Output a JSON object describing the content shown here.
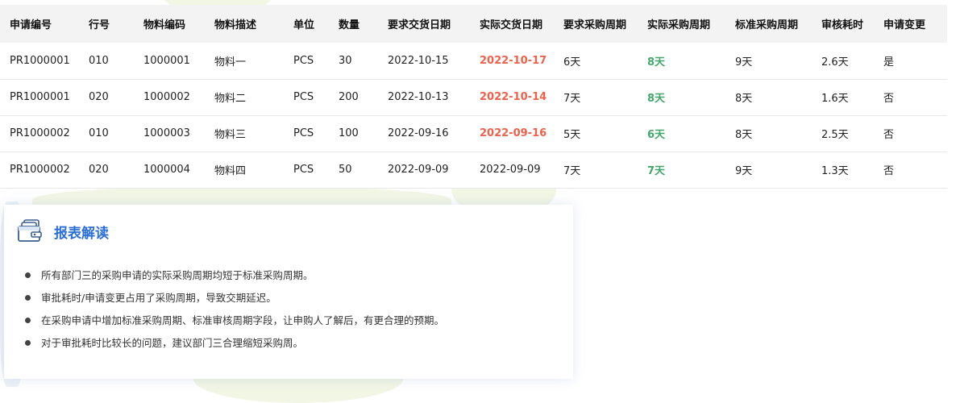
{
  "table": {
    "headers": [
      "申请编号",
      "行号",
      "物料编码",
      "物料描述",
      "单位",
      "数量",
      "要求交货日期",
      "实际交货日期",
      "要求采购周期",
      "实际采购周期",
      "标准采购周期",
      "审核耗时",
      "申请变更"
    ],
    "rows": [
      [
        "PR1000001",
        "010",
        "1000001",
        "物料一",
        "PCS",
        "30",
        "2022-10-15",
        "2022-10-17",
        "6天",
        "8天",
        "9天",
        "2.6天",
        "是"
      ],
      [
        "PR1000001",
        "020",
        "1000002",
        "物料二",
        "PCS",
        "200",
        "2022-10-13",
        "2022-10-14",
        "7天",
        "8天",
        "8天",
        "1.6天",
        "否"
      ],
      [
        "PR1000002",
        "010",
        "1000003",
        "物料三",
        "PCS",
        "100",
        "2022-09-16",
        "2022-09-16",
        "5天",
        "6天",
        "8天",
        "2.5天",
        "否"
      ],
      [
        "PR1000002",
        "020",
        "1000004",
        "物料四",
        "PCS",
        "50",
        "2022-09-09",
        "2022-09-09",
        "7天",
        "7天",
        "9天",
        "1.3天",
        "否"
      ]
    ],
    "late_delivery_highlight": [
      true,
      true,
      true,
      false
    ],
    "colors": {
      "late": "#f0604a",
      "good": "#43a66a",
      "header_bg": "#f3f3f3"
    }
  },
  "report": {
    "title": "报表解读",
    "icon": "document-stack-icon",
    "title_color": "#2b6fd6",
    "points": [
      "所有部门三的采购申请的实际采购周期均短于标准采购周期。",
      "审批耗时/申请变更占用了采购周期，导致交期延迟。",
      "在采购申请中增加标准采购周期、标准审核周期字段，让申购人了解后，有更合理的预期。",
      "对于审批耗时比较长的问题，建议部门三合理缩短采购周。"
    ]
  }
}
